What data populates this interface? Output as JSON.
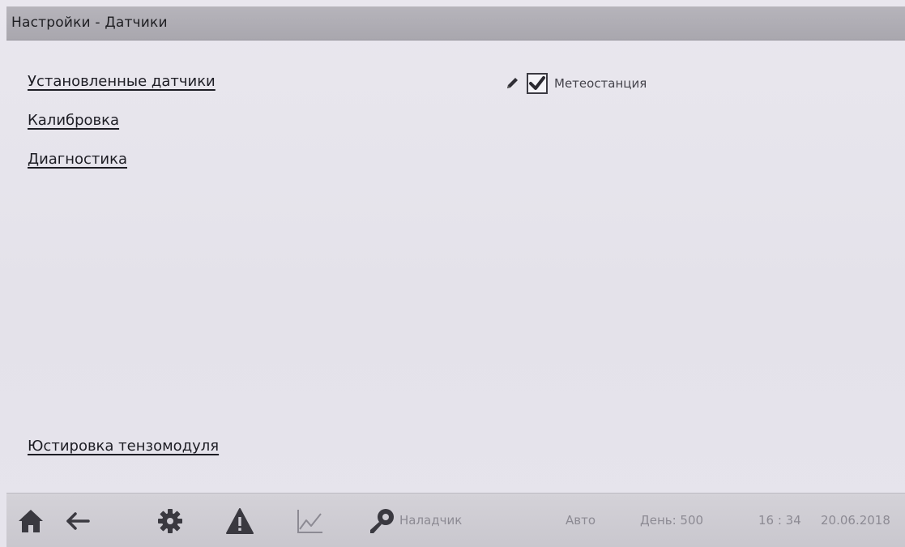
{
  "header": {
    "title": "Настройки - Датчики"
  },
  "menu": {
    "items": [
      {
        "label": "Установленные датчики"
      },
      {
        "label": "Калибровка"
      },
      {
        "label": "Диагностика"
      }
    ],
    "bottom_item": {
      "label": "Юстировка тензомодуля"
    }
  },
  "sensor": {
    "label": "Метеостанция",
    "checked": true,
    "edit_icon": "pencil-icon"
  },
  "footer": {
    "icons": [
      "home-icon",
      "back-arrow-icon",
      "gear-icon",
      "warning-icon",
      "chart-icon",
      "key-icon"
    ],
    "user": "Наладчик",
    "mode": "Авто",
    "day": "День: 500",
    "time": "16 : 34",
    "date": "20.06.2018"
  },
  "colors": {
    "background": "#e6e4ec",
    "titlebar": "#aeacb3",
    "text_dark": "#1d1d24",
    "icon_dark": "#3a3940",
    "icon_light": "#8c8a93"
  }
}
